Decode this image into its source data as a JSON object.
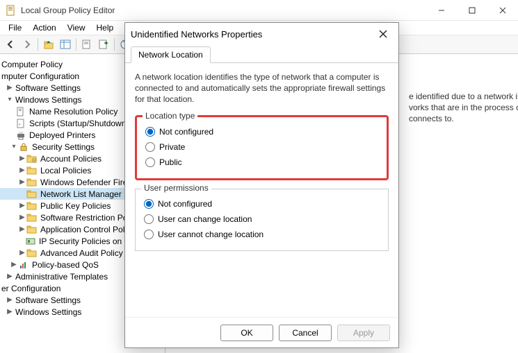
{
  "window": {
    "title": "Local Group Policy Editor"
  },
  "menu": {
    "file": "File",
    "action": "Action",
    "view": "View",
    "help": "Help"
  },
  "tree": {
    "root": "Computer Policy",
    "l1a": "mputer Configuration",
    "l2a": "Software Settings",
    "l2b": "Windows Settings",
    "nrp": "Name Resolution Policy",
    "scripts": "Scripts (Startup/Shutdown)",
    "printers": "Deployed Printers",
    "security": "Security Settings",
    "acct": "Account Policies",
    "local": "Local Policies",
    "wdf": "Windows Defender Firew",
    "nlmp": "Network List Manager Po",
    "pkp": "Public Key Policies",
    "srp": "Software Restriction Polici",
    "acp": "Application Control Polici",
    "ipsec": "IP Security Policies on Lo",
    "aapc": "Advanced Audit Policy C",
    "qos": "Policy-based QoS",
    "admin": "Administrative Templates",
    "uconf": "er Configuration",
    "ss2": "Software Settings",
    "ws2": "Windows Settings"
  },
  "content": {
    "l1": "e identified due to a network issu",
    "l2": "vorks that are in the process of be",
    "l3": "connects to."
  },
  "dialog": {
    "title": "Unidentified Networks Properties",
    "tab": "Network Location",
    "description": "A network location identifies the type of network that a computer is connected to and automatically sets the appropriate firewall settings for that location.",
    "group1": {
      "legend": "Location type",
      "opt1": "Not configured",
      "opt2": "Private",
      "opt3": "Public"
    },
    "group2": {
      "legend": "User permissions",
      "opt1": "Not configured",
      "opt2": "User can change location",
      "opt3": "User cannot change location"
    },
    "buttons": {
      "ok": "OK",
      "cancel": "Cancel",
      "apply": "Apply"
    }
  }
}
